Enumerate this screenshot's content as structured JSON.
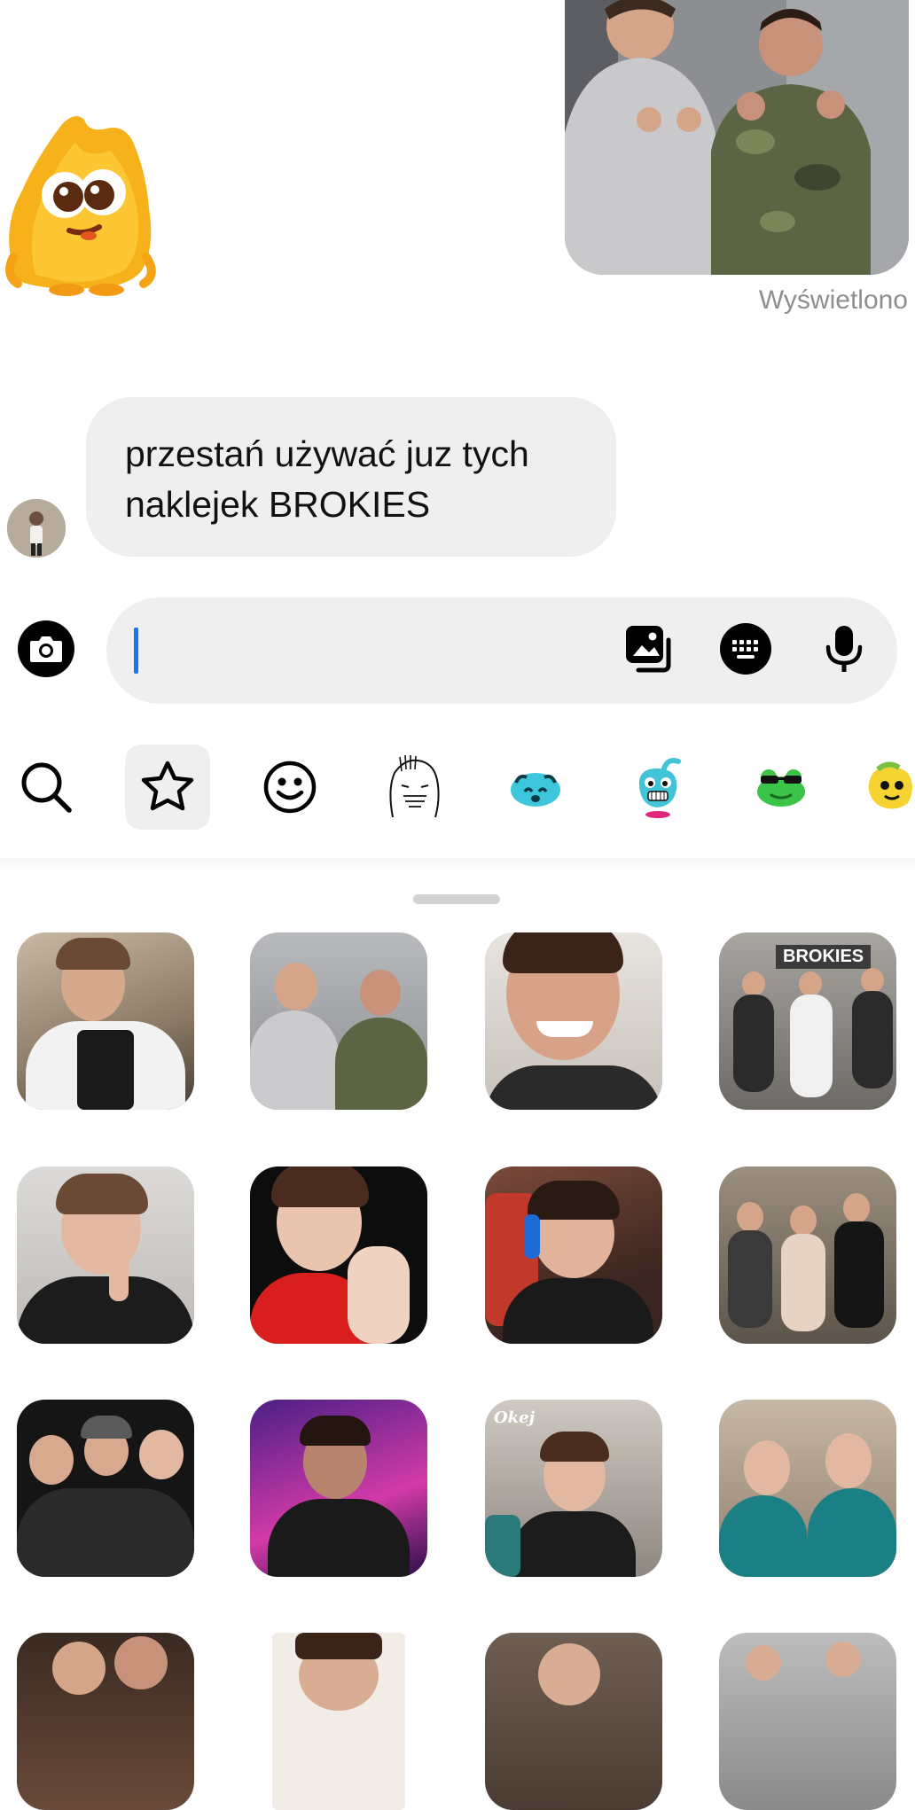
{
  "conversation": {
    "seen_label": "Wyświetlono",
    "incoming_message": {
      "lines": [
        "przestań używać juz tych",
        "naklejek BROKIES"
      ]
    }
  },
  "composer": {
    "placeholder": ""
  },
  "sticker_tabs": [
    {
      "name": "search",
      "icon": "search-icon",
      "active": false
    },
    {
      "name": "favorites",
      "icon": "star-icon",
      "active": true
    },
    {
      "name": "emoji",
      "icon": "smiley-icon",
      "active": false
    },
    {
      "name": "pack-1",
      "icon": "sketch-face-sticker",
      "active": false
    },
    {
      "name": "pack-2",
      "icon": "cyan-blob-sticker",
      "active": false
    },
    {
      "name": "pack-3",
      "icon": "cyan-creature-sticker",
      "active": false
    },
    {
      "name": "pack-4",
      "icon": "green-frog-sticker",
      "active": false
    },
    {
      "name": "pack-5",
      "icon": "yellow-creature-sticker",
      "active": false
    }
  ],
  "stickers": {
    "row1": [
      "sticker-1",
      "sticker-2",
      "sticker-3",
      "sticker-4"
    ],
    "row2": [
      "sticker-5",
      "sticker-6",
      "sticker-7",
      "sticker-8"
    ],
    "row3": [
      "sticker-9",
      "sticker-10",
      "sticker-11",
      "sticker-12"
    ],
    "row4": [
      "sticker-13",
      "sticker-14",
      "sticker-15",
      "sticker-16"
    ],
    "text_overlays": {
      "sticker_4": "BROKIES",
      "sticker_11": "Okej"
    }
  },
  "colors": {
    "accent": "#1877f2",
    "bubble_bg": "#efefef",
    "seen_text": "#8e8e8e"
  }
}
